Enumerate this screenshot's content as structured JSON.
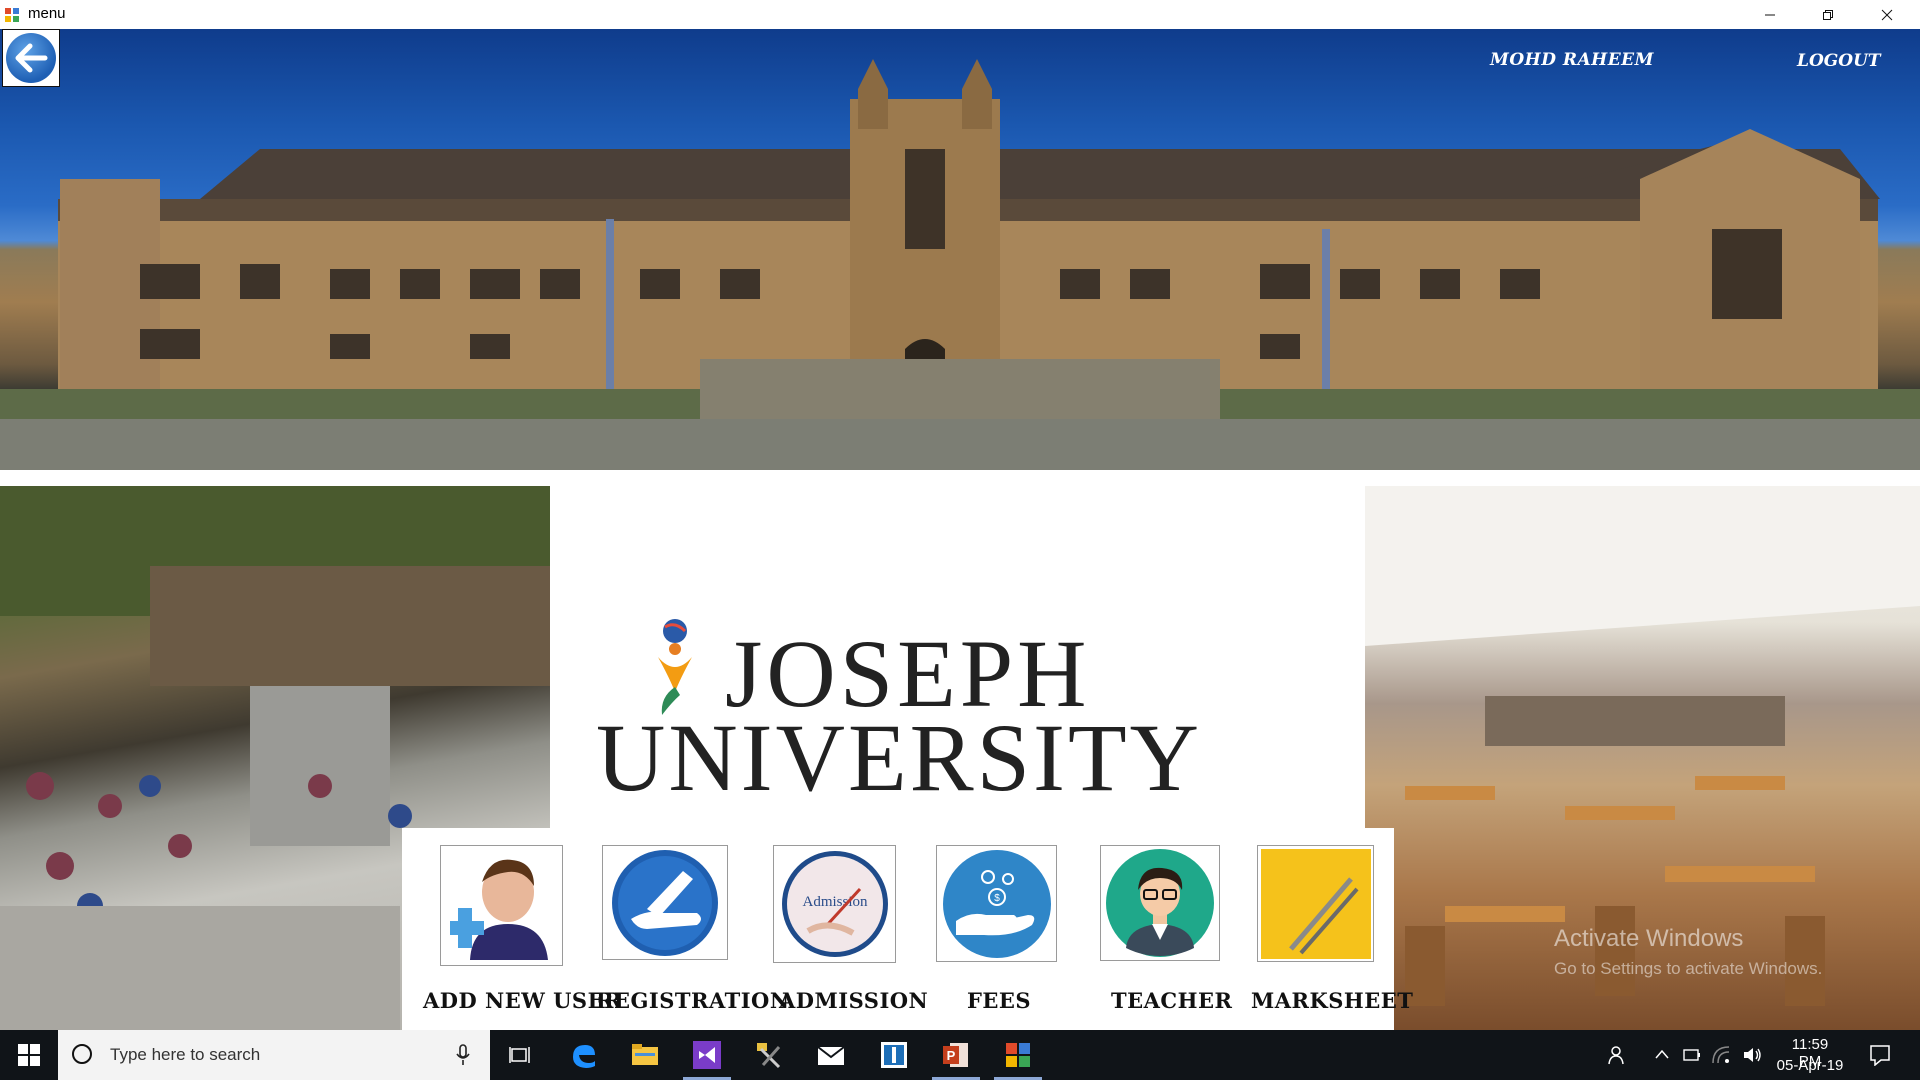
{
  "window": {
    "title": "menu"
  },
  "header": {
    "user_name": "MOHD RAHEEM",
    "logout_label": "LOGOUT"
  },
  "logo": {
    "line1": "JOSEPH",
    "line2": "UNIVERSITY"
  },
  "menu": {
    "items": [
      {
        "label": "ADD NEW USER",
        "icon": "add-user-icon"
      },
      {
        "label": "REGISTRATION",
        "icon": "registration-icon"
      },
      {
        "label": "ADMISSION",
        "icon": "admission-icon",
        "icon_text": "Admission"
      },
      {
        "label": "FEES",
        "icon": "fees-icon"
      },
      {
        "label": "TEACHER",
        "icon": "teacher-icon"
      },
      {
        "label": "MARKSHEET",
        "icon": "marksheet-icon"
      }
    ]
  },
  "activation": {
    "line1": "Activate Windows",
    "line2": "Go to Settings to activate Windows."
  },
  "taskbar": {
    "search_placeholder": "Type here to search",
    "time": "11:59 PM",
    "date": "05-Apr-19"
  },
  "colors": {
    "hero_sky": "#1b58b0",
    "taskbar_bg": "#101418",
    "tile_border": "#9a9a9a"
  }
}
